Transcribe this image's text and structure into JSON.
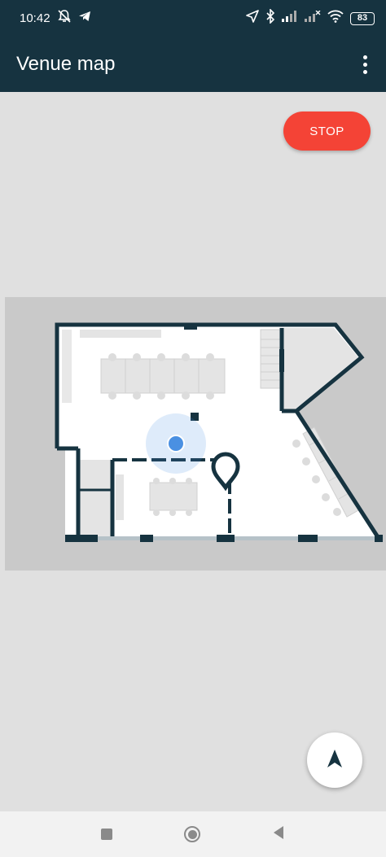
{
  "status_bar": {
    "time": "10:42",
    "battery": "83",
    "icons_left": [
      "mute-icon",
      "telegram-icon"
    ],
    "icons_right": [
      "location-arrow-icon",
      "bluetooth-icon",
      "signal-icon",
      "signal-x-icon",
      "wifi-icon",
      "battery-icon"
    ]
  },
  "app_bar": {
    "title": "Venue map",
    "menu_icon": "more-vert-icon"
  },
  "map": {
    "stop_label": "STOP",
    "stop_color": "#f44336",
    "current_location_color": "#4a90e2",
    "wall_color": "#163340",
    "marker_icon": "map-pin-icon"
  },
  "fab": {
    "icon": "navigation-arrow-icon"
  },
  "system_nav": {
    "icons": [
      "recents-icon",
      "home-icon",
      "back-icon"
    ]
  },
  "colors": {
    "app_bar": "#163340",
    "map_background": "#e0e0e0",
    "floor": "#ffffff",
    "outside": "#c9c9c9"
  }
}
